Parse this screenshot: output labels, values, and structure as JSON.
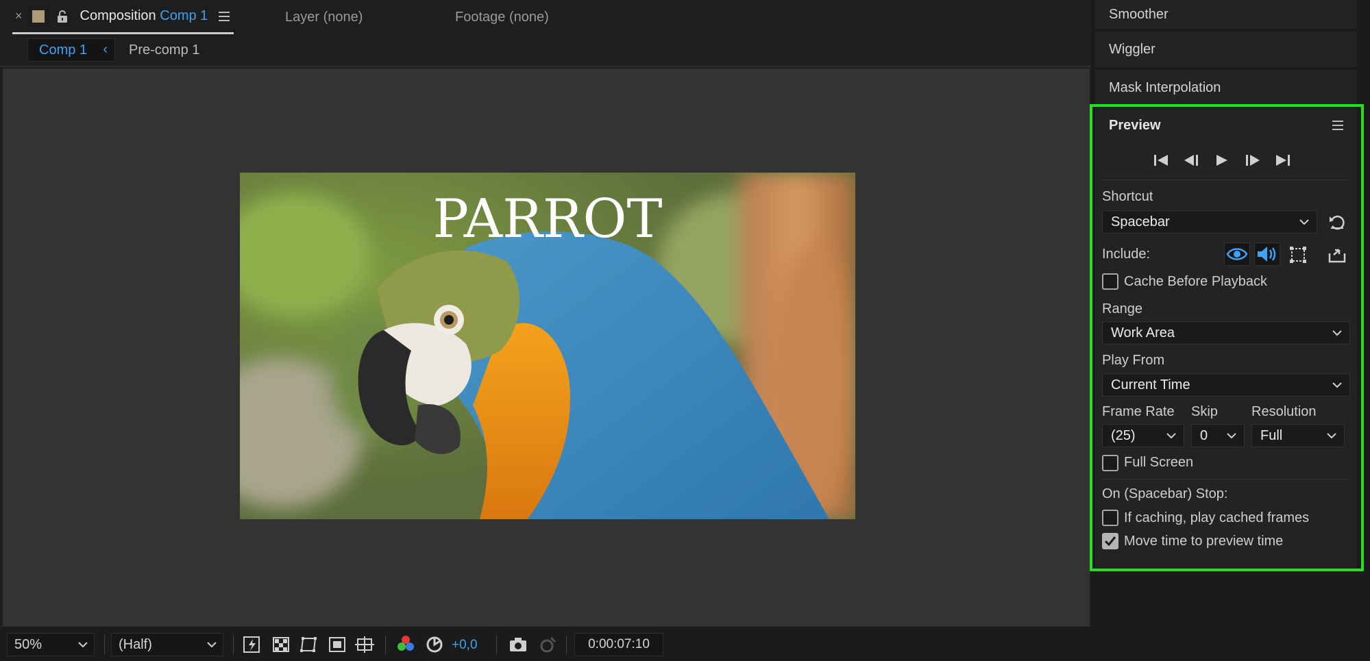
{
  "tabs": {
    "close": "×",
    "composition_prefix": "Composition",
    "composition_name": "Comp 1",
    "layer": "Layer (none)",
    "footage": "Footage (none)"
  },
  "breadcrumbs": {
    "current": "Comp 1",
    "chevron": "‹",
    "parent": "Pre-comp 1"
  },
  "viewer": {
    "image_title": "PARROT"
  },
  "bottom_bar": {
    "zoom": "50%",
    "resolution": "(Half)",
    "exposure": "+0,0",
    "timecode": "0:00:07:10"
  },
  "right_panel": {
    "panels": [
      "Smoother",
      "Wiggler",
      "Mask Interpolation"
    ],
    "preview": {
      "title": "Preview",
      "shortcut_label": "Shortcut",
      "shortcut_value": "Spacebar",
      "include_label": "Include:",
      "cache_before_playback": {
        "label": "Cache Before Playback",
        "checked": false
      },
      "range_label": "Range",
      "range_value": "Work Area",
      "play_from_label": "Play From",
      "play_from_value": "Current Time",
      "frame_rate_label": "Frame Rate",
      "frame_rate_value": "(25)",
      "skip_label": "Skip",
      "skip_value": "0",
      "resolution_label": "Resolution",
      "resolution_value": "Full",
      "full_screen": {
        "label": "Full Screen",
        "checked": false
      },
      "on_stop_label": "On (Spacebar) Stop:",
      "if_caching": {
        "label": "If caching, play cached frames",
        "checked": false
      },
      "move_time": {
        "label": "Move time to preview time",
        "checked": true
      }
    }
  },
  "colors": {
    "accent": "#3fa2f5",
    "highlight": "#2bdc22",
    "panel": "#232323",
    "viewer": "#333333"
  }
}
